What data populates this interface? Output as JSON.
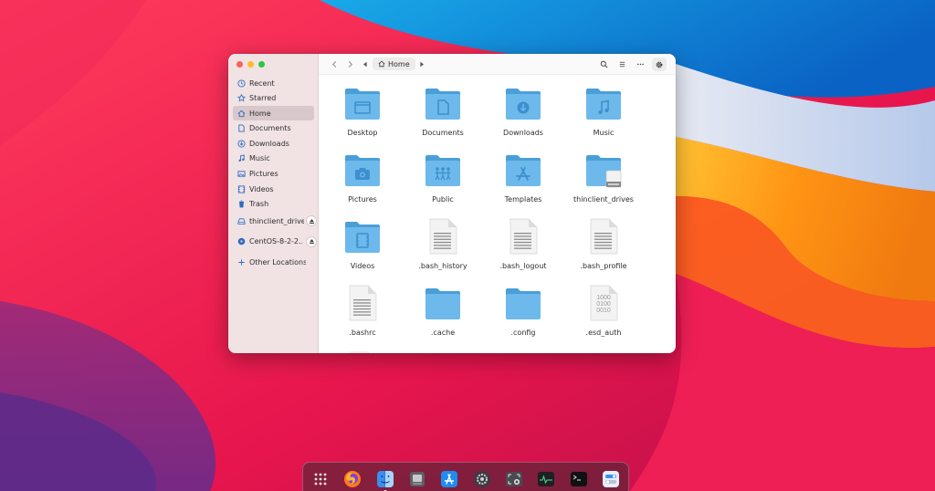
{
  "sidebar": {
    "items": [
      {
        "label": "Recent",
        "icon": "clock-icon"
      },
      {
        "label": "Starred",
        "icon": "star-icon"
      },
      {
        "label": "Home",
        "icon": "home-icon",
        "active": true
      },
      {
        "label": "Documents",
        "icon": "document-icon"
      },
      {
        "label": "Downloads",
        "icon": "download-icon"
      },
      {
        "label": "Music",
        "icon": "music-note-icon"
      },
      {
        "label": "Pictures",
        "icon": "image-icon"
      },
      {
        "label": "Videos",
        "icon": "film-icon"
      },
      {
        "label": "Trash",
        "icon": "trash-icon"
      },
      {
        "label": "thinclient_drives",
        "icon": "drive-icon",
        "ejectable": true
      },
      {
        "label": "CentOS-8-2-2...",
        "icon": "disc-icon",
        "ejectable": true
      },
      {
        "label": "Other Locations",
        "icon": "plus-icon"
      }
    ]
  },
  "header": {
    "path": "Home"
  },
  "files": [
    {
      "name": "Desktop",
      "type": "folder",
      "emblem": "desktop"
    },
    {
      "name": "Documents",
      "type": "folder",
      "emblem": "document"
    },
    {
      "name": "Downloads",
      "type": "folder",
      "emblem": "download"
    },
    {
      "name": "Music",
      "type": "folder",
      "emblem": "music"
    },
    {
      "name": "Pictures",
      "type": "folder",
      "emblem": "camera"
    },
    {
      "name": "Public",
      "type": "folder",
      "emblem": "people"
    },
    {
      "name": "Templates",
      "type": "folder",
      "emblem": "apps"
    },
    {
      "name": "thinclient_drives",
      "type": "folder-drive",
      "emblem": "drive"
    },
    {
      "name": "Videos",
      "type": "folder",
      "emblem": "film"
    },
    {
      "name": ".bash_history",
      "type": "text"
    },
    {
      "name": ".bash_logout",
      "type": "text"
    },
    {
      "name": ".bash_profile",
      "type": "text"
    },
    {
      "name": ".bashrc",
      "type": "text"
    },
    {
      "name": ".cache",
      "type": "folder",
      "emblem": ""
    },
    {
      "name": ".config",
      "type": "folder",
      "emblem": ""
    },
    {
      "name": ".esd_auth",
      "type": "binary",
      "binary_text": [
        "1000",
        "0100",
        "0010"
      ]
    }
  ],
  "dock": {
    "items": [
      {
        "name": "app-grid-icon"
      },
      {
        "name": "firefox-icon"
      },
      {
        "name": "finder-icon",
        "running": true
      },
      {
        "name": "disk-utility-icon"
      },
      {
        "name": "app-store-icon"
      },
      {
        "name": "settings-icon"
      },
      {
        "name": "screenshot-icon"
      },
      {
        "name": "activity-monitor-icon"
      },
      {
        "name": "terminal-icon"
      },
      {
        "name": "tweaks-icon"
      }
    ]
  },
  "colors": {
    "folder_back": "#4a9fd8",
    "folder_front": "#6db9ec",
    "sidebar_bg": "#f1e2e4",
    "accent": "#2b6cc4"
  }
}
